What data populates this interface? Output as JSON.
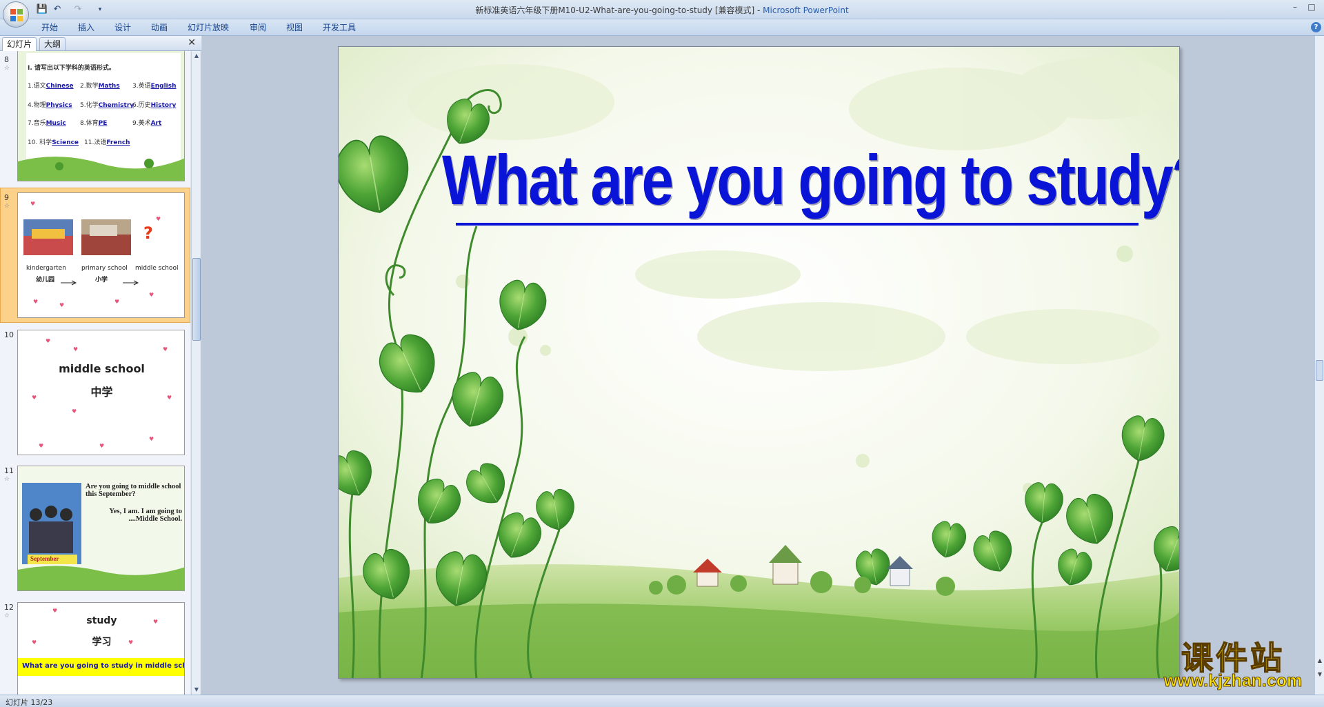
{
  "window": {
    "title": "新标准英语六年级下册M10-U2-What-are-you-going-to-study [兼容模式]",
    "separator": " - ",
    "app_name": "Microsoft PowerPoint",
    "controls": [
      "–",
      "□",
      "✕"
    ]
  },
  "quick_access": {
    "save": "💾",
    "undo": "↶",
    "redo": "↷",
    "customize": "▾"
  },
  "ribbon": {
    "tabs": [
      "开始",
      "插入",
      "设计",
      "动画",
      "幻灯片放映",
      "审阅",
      "视图",
      "开发工具"
    ],
    "help": "?"
  },
  "left_pane": {
    "tabs": [
      "幻灯片",
      "大纲"
    ],
    "close": "✕",
    "slides": [
      {
        "number": "8",
        "question": "I. 请写出以下学科的英语形式。",
        "answers": [
          [
            "1.语文",
            "Chinese"
          ],
          [
            "2.数学",
            "Maths"
          ],
          [
            "3.英语",
            "English"
          ],
          [
            "4.物理",
            "Physics"
          ],
          [
            "5.化学",
            "Chemistry"
          ],
          [
            "6.历史",
            "History"
          ],
          [
            "7.音乐",
            "Music"
          ],
          [
            "8.体育",
            "PE"
          ],
          [
            "9.美术",
            "Art"
          ],
          [
            "10. 科学",
            "Science"
          ],
          [
            "11.法语",
            "French"
          ]
        ]
      },
      {
        "number": "9",
        "labels": [
          "kindergarten",
          "primary school",
          "middle school"
        ],
        "cn_labels": [
          "幼儿园",
          "小学"
        ],
        "question_mark": "?"
      },
      {
        "number": "10",
        "en": "middle school",
        "cn": "中学"
      },
      {
        "number": "11",
        "q1": "Are you going to middle school this September?",
        "a1": "Yes, I am. I am going to ....Middle School.",
        "caption": "September"
      },
      {
        "number": "12",
        "en": "study",
        "cn": "学习",
        "sentence": "What are you going to study in middle school?"
      }
    ]
  },
  "slide": {
    "title": "What are you going to study?",
    "colors": {
      "title": "#0a14d6",
      "sky": "#ffffff",
      "grass": "#7fbf4a",
      "leaf": "#3d9a2c"
    }
  },
  "status_bar": {
    "text": "幻灯片 13/23"
  },
  "watermark": {
    "cn": "课件站",
    "url": "www.kjzhan.com"
  }
}
